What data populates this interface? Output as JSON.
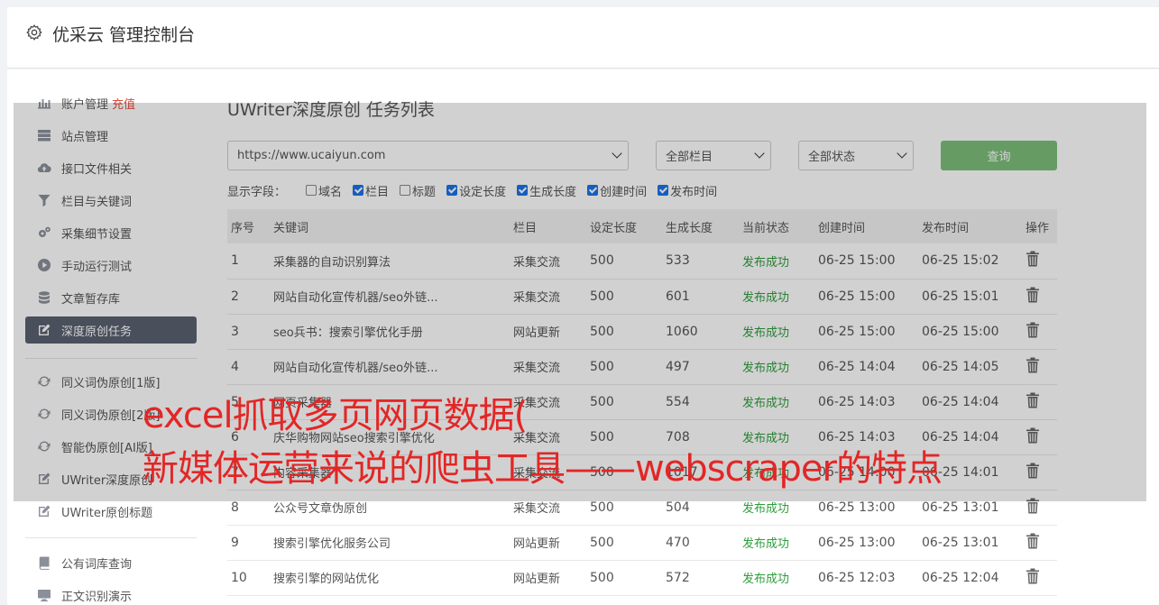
{
  "header": {
    "title": "优采云 管理控制台"
  },
  "sidebar": {
    "items": [
      {
        "label": "账户管理",
        "badge": "充值",
        "icon": "bar-chart-icon"
      },
      {
        "label": "站点管理",
        "icon": "server-icon"
      },
      {
        "label": "接口文件相关",
        "icon": "cloud-upload-icon"
      },
      {
        "label": "栏目与关键词",
        "icon": "filter-icon"
      },
      {
        "label": "采集细节设置",
        "icon": "cogs-icon"
      },
      {
        "label": "手动运行测试",
        "icon": "play-circle-icon"
      },
      {
        "label": "文章暂存库",
        "icon": "database-icon"
      },
      {
        "label": "深度原创任务",
        "icon": "edit-icon",
        "active": true
      },
      {
        "label": "同义词伪原创[1版]",
        "icon": "refresh-icon"
      },
      {
        "label": "同义词伪原创[2版]",
        "icon": "refresh-icon"
      },
      {
        "label": "智能伪原创[AI版]",
        "icon": "refresh-icon"
      },
      {
        "label": "UWriter深度原创",
        "icon": "edit-icon"
      },
      {
        "label": "UWriter原创标题",
        "icon": "edit-icon"
      },
      {
        "label": "公有词库查询",
        "icon": "book-icon"
      },
      {
        "label": "正文识别演示",
        "icon": "monitor-icon"
      }
    ]
  },
  "main": {
    "title": "UWriter深度原创 任务列表",
    "filters": {
      "site": "https://www.ucaiyun.com",
      "category": "全部栏目",
      "status": "全部状态",
      "query_label": "查询"
    },
    "fields_label": "显示字段：",
    "fields": [
      {
        "label": "域名",
        "checked": false
      },
      {
        "label": "栏目",
        "checked": true
      },
      {
        "label": "标题",
        "checked": false
      },
      {
        "label": "设定长度",
        "checked": true
      },
      {
        "label": "生成长度",
        "checked": true
      },
      {
        "label": "创建时间",
        "checked": true
      },
      {
        "label": "发布时间",
        "checked": true
      }
    ],
    "table": {
      "headers": [
        "序号",
        "关键词",
        "栏目",
        "设定长度",
        "生成长度",
        "当前状态",
        "创建时间",
        "发布时间",
        "操作"
      ],
      "rows": [
        [
          "1",
          "采集器的自动识别算法",
          "采集交流",
          "500",
          "533",
          "发布成功",
          "06-25 15:00",
          "06-25 15:02"
        ],
        [
          "2",
          "网站自动化宣传机器/seo外链...",
          "采集交流",
          "500",
          "601",
          "发布成功",
          "06-25 15:00",
          "06-25 15:01"
        ],
        [
          "3",
          "seo兵书：搜索引擎优化手册",
          "网站更新",
          "500",
          "1060",
          "发布成功",
          "06-25 15:00",
          "06-25 15:00"
        ],
        [
          "4",
          "网站自动化宣传机器/seo外链...",
          "采集交流",
          "500",
          "497",
          "发布成功",
          "06-25 14:04",
          "06-25 14:05"
        ],
        [
          "5",
          "网页采集器",
          "采集交流",
          "500",
          "554",
          "发布成功",
          "06-25 14:03",
          "06-25 14:04"
        ],
        [
          "6",
          "庆华购物网站seo搜索引擎优化",
          "采集交流",
          "500",
          "708",
          "发布成功",
          "06-25 14:03",
          "06-25 14:04"
        ],
        [
          "7",
          "内容采集器",
          "采集交流",
          "500",
          "1017",
          "发布成功",
          "06-25 14:00",
          "06-25 14:01"
        ],
        [
          "8",
          "公众号文章伪原创",
          "采集交流",
          "500",
          "504",
          "发布成功",
          "06-25 13:00",
          "06-25 13:01"
        ],
        [
          "9",
          "搜索引擎优化服务公司",
          "网站更新",
          "500",
          "470",
          "发布成功",
          "06-25 13:00",
          "06-25 13:01"
        ],
        [
          "10",
          "搜索引擎的网站优化",
          "网站更新",
          "500",
          "572",
          "发布成功",
          "06-25 12:03",
          "06-25 12:04"
        ]
      ]
    }
  },
  "overlay": {
    "caption_line1": "excel抓取多页网页数据(",
    "caption_line2": "新媒体运营来说的爬虫工具——webscraper的特点"
  },
  "colors": {
    "accent_active": "#5a6170",
    "success": "#2e9d3b",
    "query_button": "#7dbf7b",
    "caption": "#e32626",
    "badge": "#e04a3b"
  }
}
